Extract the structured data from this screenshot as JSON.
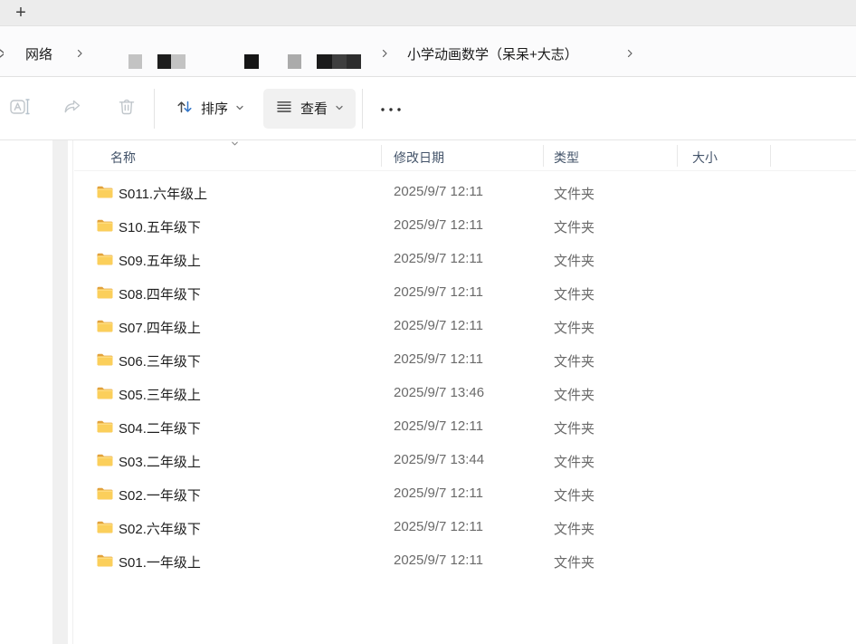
{
  "tab_bar": {
    "new_tab_label": "+"
  },
  "breadcrumb": {
    "back_fragment": "›",
    "root": "网络",
    "separator": "›",
    "current": "小学动画数学（呆呆+大志）",
    "redacted_blocks": [
      {
        "gap": 0,
        "w": 15,
        "color": "#c3c3c3"
      },
      {
        "gap": 17,
        "w": 15,
        "color": "#1d1d1d"
      },
      {
        "gap": 0,
        "w": 16,
        "color": "#c3c3c3"
      },
      {
        "gap": 65,
        "w": 16,
        "color": "#161616"
      },
      {
        "gap": 32,
        "w": 15,
        "color": "#ababab"
      },
      {
        "gap": 17,
        "w": 17,
        "color": "#1b1b1b"
      },
      {
        "gap": 0,
        "w": 16,
        "color": "#3f3f3f"
      },
      {
        "gap": 0,
        "w": 16,
        "color": "#2d2d2d"
      }
    ]
  },
  "toolbar": {
    "rename_icon": "rename-icon",
    "share_icon": "share-icon",
    "delete_icon": "trash-icon",
    "sort_icon": "sort-arrows-icon",
    "sort_label": "排序",
    "view_icon": "list-lines-icon",
    "view_label": "查看",
    "more_icon": "ellipsis-icon"
  },
  "table": {
    "columns": [
      {
        "key": "name",
        "label": "名称"
      },
      {
        "key": "date",
        "label": "修改日期"
      },
      {
        "key": "type",
        "label": "类型"
      },
      {
        "key": "size",
        "label": "大小"
      }
    ],
    "sort": {
      "column": "名称",
      "direction": "descending"
    },
    "rows": [
      {
        "name": "S011.六年级上",
        "date": "2025/9/7 12:11",
        "type": "文件夹",
        "size": ""
      },
      {
        "name": "S10.五年级下",
        "date": "2025/9/7 12:11",
        "type": "文件夹",
        "size": ""
      },
      {
        "name": "S09.五年级上",
        "date": "2025/9/7 12:11",
        "type": "文件夹",
        "size": ""
      },
      {
        "name": "S08.四年级下",
        "date": "2025/9/7 12:11",
        "type": "文件夹",
        "size": ""
      },
      {
        "name": "S07.四年级上",
        "date": "2025/9/7 12:11",
        "type": "文件夹",
        "size": ""
      },
      {
        "name": "S06.三年级下",
        "date": "2025/9/7 12:11",
        "type": "文件夹",
        "size": ""
      },
      {
        "name": "S05.三年级上",
        "date": "2025/9/7 13:46",
        "type": "文件夹",
        "size": ""
      },
      {
        "name": "S04.二年级下",
        "date": "2025/9/7 12:11",
        "type": "文件夹",
        "size": ""
      },
      {
        "name": "S03.二年级上",
        "date": "2025/9/7 13:44",
        "type": "文件夹",
        "size": ""
      },
      {
        "name": "S02.一年级下",
        "date": "2025/9/7 12:11",
        "type": "文件夹",
        "size": ""
      },
      {
        "name": "S02.六年级下",
        "date": "2025/9/7 12:11",
        "type": "文件夹",
        "size": ""
      },
      {
        "name": "S01.一年级上",
        "date": "2025/9/7 12:11",
        "type": "文件夹",
        "size": ""
      }
    ]
  },
  "colors": {
    "accent_blue": "#3577c8",
    "header_text": "#44546a",
    "tab_bar_bg": "#ececec",
    "view_button_bg": "#f1f1f1",
    "folder_body": "#fbcf5b",
    "folder_flap": "#e2a23c",
    "disabled_icon": "#c0c6cb",
    "text_primary": "#1f1f1f",
    "text_secondary": "#6a6a6a"
  }
}
